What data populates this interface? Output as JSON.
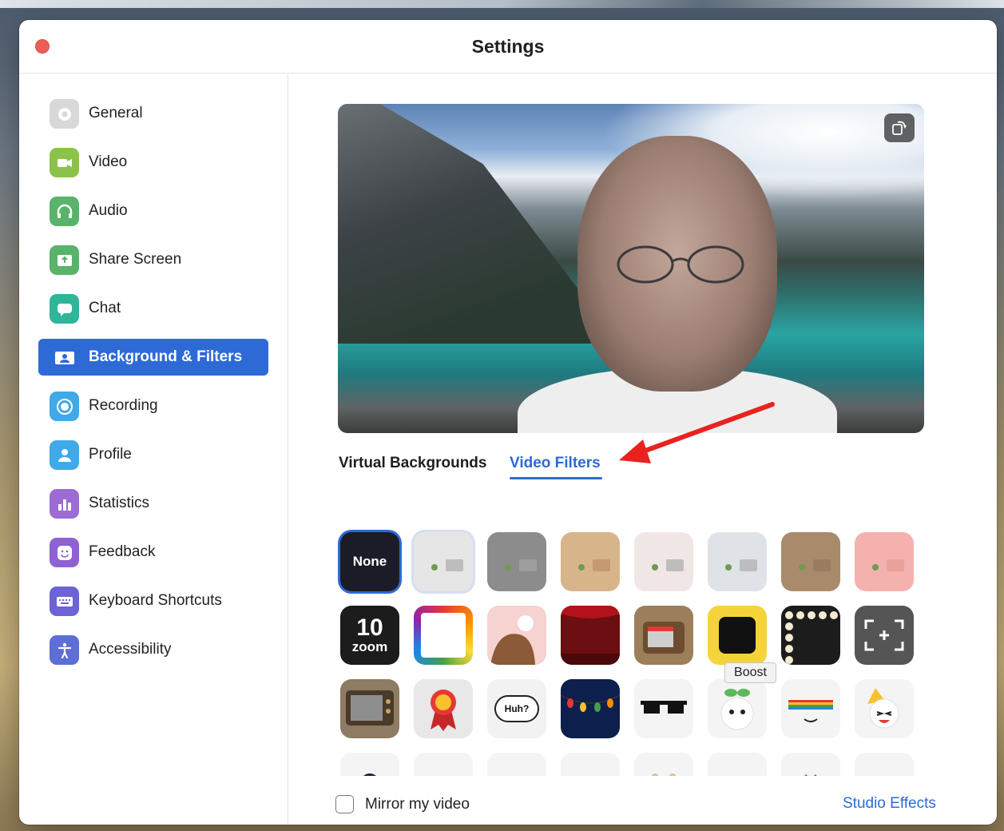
{
  "window": {
    "title": "Settings"
  },
  "sidebar": {
    "items": [
      {
        "label": "General",
        "icon": "gear-icon",
        "color": "#d8d8d8"
      },
      {
        "label": "Video",
        "icon": "video-camera-icon",
        "color": "#8bc34a"
      },
      {
        "label": "Audio",
        "icon": "headphones-icon",
        "color": "#59b36a"
      },
      {
        "label": "Share Screen",
        "icon": "share-screen-icon",
        "color": "#59b36a"
      },
      {
        "label": "Chat",
        "icon": "chat-bubble-icon",
        "color": "#2fb59a"
      },
      {
        "label": "Background & Filters",
        "icon": "person-card-icon",
        "color": "#2d6ad6"
      },
      {
        "label": "Recording",
        "icon": "record-icon",
        "color": "#40a9e8"
      },
      {
        "label": "Profile",
        "icon": "user-icon",
        "color": "#40a9e8"
      },
      {
        "label": "Statistics",
        "icon": "bar-chart-icon",
        "color": "#9c6bd6"
      },
      {
        "label": "Feedback",
        "icon": "smiley-icon",
        "color": "#8e62d3"
      },
      {
        "label": "Keyboard Shortcuts",
        "icon": "keyboard-icon",
        "color": "#6b63d6"
      },
      {
        "label": "Accessibility",
        "icon": "accessibility-icon",
        "color": "#5d6fd4"
      }
    ],
    "active_index": 5
  },
  "tabs": {
    "virtual_backgrounds": "Virtual Backgrounds",
    "video_filters": "Video Filters",
    "active": "video_filters"
  },
  "filters": {
    "none_label": "None",
    "tooltip": "Boost",
    "row1_colors": [
      "#e6e6e6",
      "#8c8c8c",
      "#d8b48a",
      "#f1e6e6",
      "#dfe3e7",
      "#a98b6c",
      "#f4b1ae"
    ],
    "row2_names": [
      "zoom-10-icon",
      "pride-frame-icon",
      "cow-icon",
      "theater-icon",
      "retro-tv-icon",
      "emoji-frame-icon",
      "lights-frame-icon",
      "focus-frame-icon"
    ],
    "row3_names": [
      "tv-icon",
      "award-ribbon-icon",
      "speech-bubble-icon",
      "string-lights-icon",
      "sunglasses-icon",
      "sprout-icon",
      "rainbow-icon",
      "party-hat-icon"
    ],
    "row3_speech": "Huh?",
    "row2_zoom_label": "zoom",
    "row2_zoom_number": "10"
  },
  "footer": {
    "mirror_label": "Mirror my video",
    "mirror_checked": false,
    "studio_effects": "Studio Effects"
  },
  "colors": {
    "accent": "#2d6ad6",
    "arrow": "#e8231f"
  }
}
